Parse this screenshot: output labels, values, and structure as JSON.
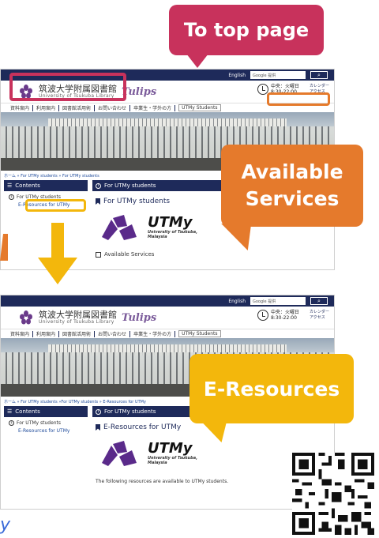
{
  "callouts": {
    "top_page": "To top page",
    "available_line1": "Available",
    "available_line2": "Services",
    "eresources": "E-Resources"
  },
  "colors": {
    "top_page": "#c8325c",
    "available": "#e57a2c",
    "eresources": "#f3b70c",
    "navy": "#1e2a5a"
  },
  "site": {
    "english": "English",
    "google_search": "Google 提供",
    "search_icon": "search-icon",
    "lib_name": "筑波大学附属図書館",
    "lib_sub": "University of Tsukuba Library",
    "tulips": "Tulips",
    "hours_line1": "中央：火曜日",
    "hours_line2": "8:30-22:00",
    "calendar_line1": "カレンダー",
    "calendar_line2": "アクセス"
  },
  "shot1": {
    "nav": [
      "資料案内",
      "利用案内",
      "図書館活用術",
      "お問い合わせ",
      "卒業生・学外の方",
      "UTMy Students"
    ],
    "breadcrumb": "ホーム » For UTMy students » For UTMy students",
    "contents_label": "Contents",
    "side_item": "For UTMy students",
    "side_sub": "E-Resources for UTMy",
    "main_head": "For UTMy students",
    "main_title": "For UTMy students",
    "utmy_logo": "UTMy",
    "utmy_sub1": "University of Tsukuba,",
    "utmy_sub2": "Malaysia",
    "available_link": "Available Services"
  },
  "shot2": {
    "nav": [
      "資料案内",
      "利用案内",
      "図書館活用術",
      "お問い合わせ",
      "卒業生・学外の方",
      "UTMy Students"
    ],
    "breadcrumb": "ホーム » For UTMy students »For UTMy students » E-Resources for UTMy",
    "contents_label": "Contents",
    "side_item": "For UTMy students",
    "side_sub": "E-Resources for UTMy",
    "main_head": "For UTMy students",
    "main_title": "E-Resources for UTMy",
    "utmy_logo": "UTMy",
    "utmy_sub1": "University of Tsukuba,",
    "utmy_sub2": "Malaysia",
    "note": "The following resources are available to UTMy students."
  },
  "bottom_left_text": "y"
}
